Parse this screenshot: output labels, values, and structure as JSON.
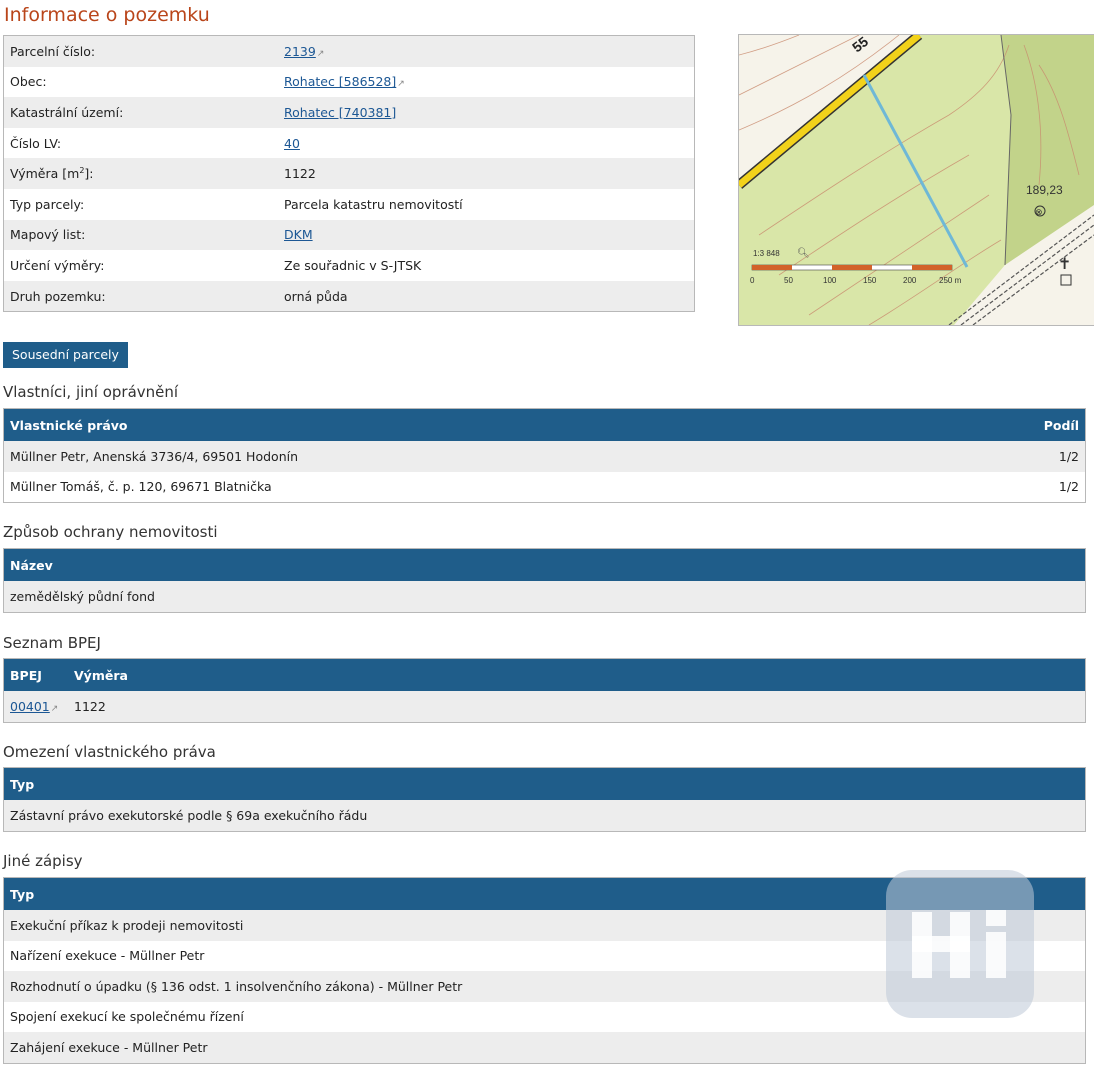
{
  "page_title": "Informace o pozemku",
  "parcel_info": {
    "rows": [
      {
        "label": "Parcelní číslo:",
        "value": "2139",
        "link": true,
        "external": true
      },
      {
        "label": "Obec:",
        "value": "Rohatec [586528]",
        "link": true,
        "external": true
      },
      {
        "label": "Katastrální území:",
        "value": "Rohatec [740381]",
        "link": true,
        "external": false
      },
      {
        "label": "Číslo LV:",
        "value": "40",
        "link": true,
        "external": false
      },
      {
        "label_main": "Výměra [m",
        "label_sup": "2",
        "label_end": "]:",
        "value": "1122",
        "link": false,
        "external": false
      },
      {
        "label": "Typ parcely:",
        "value": "Parcela katastru nemovitostí",
        "link": false,
        "external": false
      },
      {
        "label": "Mapový list:",
        "value": "DKM",
        "link": true,
        "external": false
      },
      {
        "label": "Určení výměry:",
        "value": "Ze souřadnic v S-JTSK",
        "link": false,
        "external": false
      },
      {
        "label": "Druh pozemku:",
        "value": "orná půda",
        "link": false,
        "external": false
      }
    ]
  },
  "map": {
    "road_number": "55",
    "elevation": "189,23",
    "scale": "1:3 848",
    "scale_ticks": [
      "0",
      "50",
      "100",
      "150",
      "200",
      "250 m"
    ]
  },
  "neighbors_button": "Sousední parcely",
  "owners": {
    "title": "Vlastníci, jiní oprávnění",
    "col_right": "Vlastnické právo",
    "col_share": "Podíl",
    "rows": [
      {
        "name": "Müllner Petr, Anenská 3736/4, 69501 Hodonín",
        "share": "1/2"
      },
      {
        "name": "Müllner Tomáš, č. p. 120, 69671 Blatnička",
        "share": "1/2"
      }
    ]
  },
  "protection": {
    "title": "Způsob ochrany nemovitosti",
    "col_name": "Název",
    "rows": [
      "zemědělský půdní fond"
    ]
  },
  "bpej": {
    "title": "Seznam BPEJ",
    "col_bpej": "BPEJ",
    "col_area": "Výměra",
    "rows": [
      {
        "code": "00401",
        "area": "1122"
      }
    ]
  },
  "restrictions": {
    "title": "Omezení vlastnického práva",
    "col_type": "Typ",
    "rows": [
      "Zástavní právo exekutorské podle § 69a exekučního řádu"
    ]
  },
  "other": {
    "title": "Jiné zápisy",
    "col_type": "Typ",
    "rows": [
      "Exekuční příkaz k prodeji nemovitosti",
      "Nařízení exekuce - Müllner Petr",
      "Rozhodnutí o úpadku (§ 136 odst. 1 insolvenčního zákona) - Müllner Petr",
      "Spojení exekucí ke společnému řízení",
      "Zahájení exekuce - Müllner Petr"
    ]
  },
  "watermark_text": "Hi",
  "colors": {
    "title": "#b9451a",
    "header": "#1f5d8a",
    "parcel_fill": "#d9e6a8",
    "link": "#1c5794"
  }
}
